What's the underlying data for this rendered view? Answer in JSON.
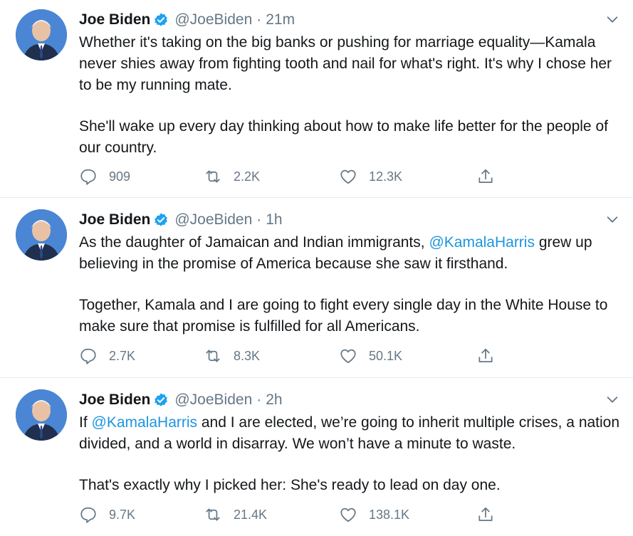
{
  "tweets": [
    {
      "name": "Joe Biden",
      "handle": "@JoeBiden",
      "separator": "·",
      "time": "21m",
      "paragraphs": [
        [
          {
            "text": "Whether it's taking on the big banks or pushing for marriage equality—Kamala never shies away from fighting tooth and nail for what's right. It's why I chose her to be my running mate.",
            "mention": false
          }
        ],
        [
          {
            "text": "She'll wake up every day thinking about how to make life better for the people of our country.",
            "mention": false
          }
        ]
      ],
      "replies": "909",
      "retweets": "2.2K",
      "likes": "12.3K"
    },
    {
      "name": "Joe Biden",
      "handle": "@JoeBiden",
      "separator": "·",
      "time": "1h",
      "paragraphs": [
        [
          {
            "text": "As the daughter of Jamaican and Indian immigrants, ",
            "mention": false
          },
          {
            "text": "@KamalaHarris",
            "mention": true
          },
          {
            "text": " grew up believing in the promise of America because she saw it firsthand.",
            "mention": false
          }
        ],
        [
          {
            "text": "Together, Kamala and I are going to fight every single day in the White House to make sure that promise is fulfilled for all Americans.",
            "mention": false
          }
        ]
      ],
      "replies": "2.7K",
      "retweets": "8.3K",
      "likes": "50.1K"
    },
    {
      "name": "Joe Biden",
      "handle": "@JoeBiden",
      "separator": "·",
      "time": "2h",
      "paragraphs": [
        [
          {
            "text": "If ",
            "mention": false
          },
          {
            "text": "@KamalaHarris",
            "mention": true
          },
          {
            "text": " and I are elected, we’re going to inherit multiple crises, a nation divided, and a world in disarray. We won’t have a minute to waste.",
            "mention": false
          }
        ],
        [
          {
            "text": "That's exactly why I picked her: She's ready to lead on day one.",
            "mention": false
          }
        ]
      ],
      "replies": "9.7K",
      "retweets": "21.4K",
      "likes": "138.1K"
    }
  ],
  "icons": {
    "verified": "verified-badge-icon",
    "caret": "chevron-down-icon",
    "reply": "reply-icon",
    "retweet": "retweet-icon",
    "like": "heart-icon",
    "share": "share-icon"
  },
  "colors": {
    "text": "#14171a",
    "secondary": "#657786",
    "link": "#1b95e0",
    "verified": "#1da1f2",
    "divider": "#e6ecf0"
  }
}
